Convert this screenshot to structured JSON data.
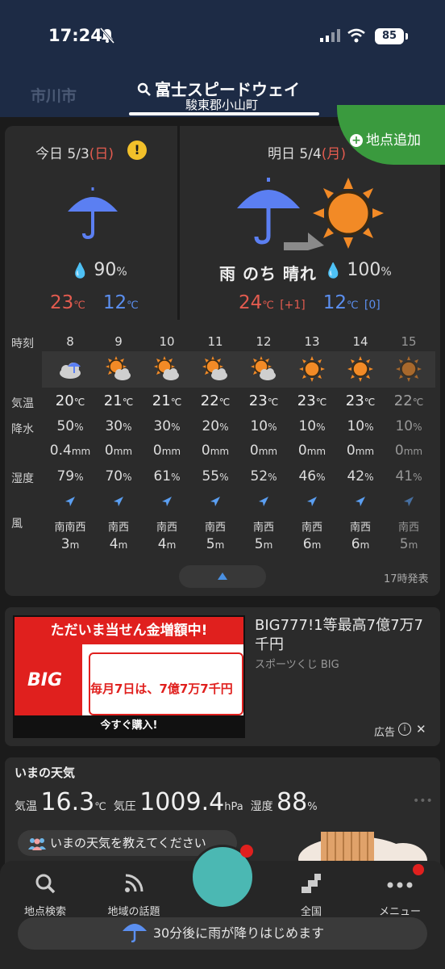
{
  "status": {
    "time": "17:24",
    "battery": "85"
  },
  "header": {
    "prev_tab": "市川市",
    "location": "富士スピードウェイ",
    "sub": "駿東郡小山町"
  },
  "add_location": "地点追加",
  "today": {
    "label": "今日",
    "date": "5/3",
    "weekday": "(日)",
    "pop": "90",
    "pop_unit": "%",
    "high": "23",
    "low": "12",
    "unit": "℃",
    "alert": "!"
  },
  "tomorrow": {
    "label": "明日",
    "date": "5/4",
    "weekday": "(月)",
    "description": "雨 のち 晴れ",
    "pop": "100",
    "pop_unit": "%",
    "high": "24",
    "high_diff": "[+1]",
    "low": "12",
    "low_diff": "[0]",
    "unit": "℃"
  },
  "hourly": {
    "labels": {
      "time": "時刻",
      "temp": "気温",
      "precip": "降水",
      "humidity": "湿度",
      "wind": "風"
    },
    "units": {
      "temp": "℃",
      "pop": "%",
      "mm": "mm",
      "hum": "%",
      "speed": "m"
    },
    "hours": [
      {
        "time": "8",
        "icon": "rain-cloud-icon",
        "temp": "20",
        "pop": "50",
        "mm": "0.4",
        "hum": "79",
        "dir": "南南西",
        "speed": "3"
      },
      {
        "time": "9",
        "icon": "sun-cloud-icon",
        "temp": "21",
        "pop": "30",
        "mm": "0",
        "hum": "70",
        "dir": "南西",
        "speed": "4"
      },
      {
        "time": "10",
        "icon": "sun-cloud-icon",
        "temp": "21",
        "pop": "30",
        "mm": "0",
        "hum": "61",
        "dir": "南西",
        "speed": "4"
      },
      {
        "time": "11",
        "icon": "sun-cloud-icon",
        "temp": "22",
        "pop": "20",
        "mm": "0",
        "hum": "55",
        "dir": "南西",
        "speed": "5"
      },
      {
        "time": "12",
        "icon": "sun-cloud-icon",
        "temp": "23",
        "pop": "10",
        "mm": "0",
        "hum": "52",
        "dir": "南西",
        "speed": "5"
      },
      {
        "time": "13",
        "icon": "sun-icon",
        "temp": "23",
        "pop": "10",
        "mm": "0",
        "hum": "46",
        "dir": "南西",
        "speed": "6"
      },
      {
        "time": "14",
        "icon": "sun-icon",
        "temp": "23",
        "pop": "10",
        "mm": "0",
        "hum": "42",
        "dir": "南西",
        "speed": "6"
      },
      {
        "time": "15",
        "icon": "sun-icon",
        "temp": "22",
        "pop": "10",
        "mm": "0",
        "hum": "41",
        "dir": "南西",
        "speed": "5"
      }
    ],
    "issued": "17時発表"
  },
  "ad": {
    "banner_top": "ただいま当せん金増額中!",
    "banner_big": "BIG",
    "banner_mid": "毎月7日は、7億7万7千円",
    "banner_buy": "今すぐ購入!",
    "title": "BIG777!1等最高7億7万7千円",
    "sponsor": "スポーツくじ BIG",
    "label": "広告"
  },
  "current": {
    "title": "いまの天気",
    "temp_label": "気温",
    "temp": "16.3",
    "temp_unit": "℃",
    "pressure_label": "気圧",
    "pressure": "1009.4",
    "pressure_unit": "hPa",
    "humidity_label": "湿度",
    "humidity": "88",
    "humidity_unit": "%",
    "report_prompt": "いまの天気を教えてください"
  },
  "tabbar": {
    "search": "地点検索",
    "topics": "地域の話題",
    "national": "全国",
    "menu": "メニュー"
  },
  "rain_notice": "30分後に雨が降りはじめます",
  "colors": {
    "accent_green": "#3a9a3e",
    "temp_high": "#e35b4f",
    "temp_low": "#5b8ff0",
    "sun_orange": "#f28a26",
    "header_navy": "#1d2b45"
  }
}
